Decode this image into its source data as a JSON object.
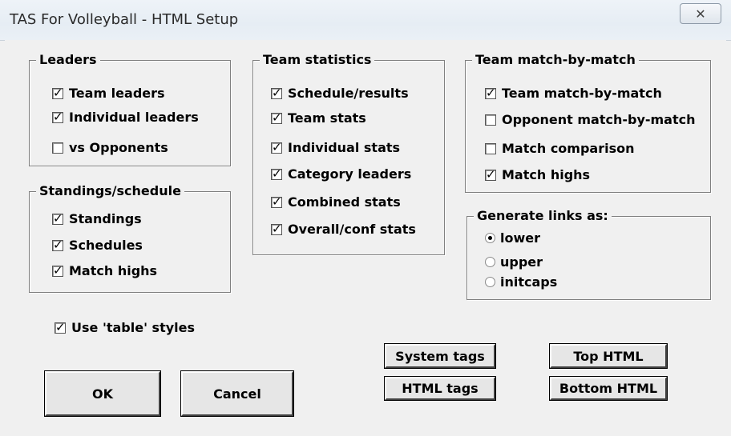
{
  "window": {
    "title": "TAS For Volleyball - HTML Setup",
    "close_glyph": "✕"
  },
  "leaders": {
    "title": "Leaders",
    "items": [
      {
        "label": "Team leaders",
        "checked": true
      },
      {
        "label": "Individual leaders",
        "checked": true
      },
      {
        "label": "vs Opponents",
        "checked": false
      }
    ]
  },
  "standings": {
    "title": "Standings/schedule",
    "items": [
      {
        "label": "Standings",
        "checked": true
      },
      {
        "label": "Schedules",
        "checked": true
      },
      {
        "label": "Match highs",
        "checked": true
      }
    ]
  },
  "team_stats": {
    "title": "Team statistics",
    "items": [
      {
        "label": "Schedule/results",
        "checked": true
      },
      {
        "label": "Team stats",
        "checked": true
      },
      {
        "label": "Individual stats",
        "checked": true
      },
      {
        "label": "Category leaders",
        "checked": true
      },
      {
        "label": "Combined stats",
        "checked": true
      },
      {
        "label": "Overall/conf stats",
        "checked": true
      }
    ]
  },
  "team_mbm": {
    "title": "Team match-by-match",
    "items": [
      {
        "label": "Team match-by-match",
        "checked": true
      },
      {
        "label": "Opponent match-by-match",
        "checked": false
      },
      {
        "label": "Match comparison",
        "checked": false
      },
      {
        "label": "Match highs",
        "checked": true
      }
    ]
  },
  "links": {
    "title": "Generate links as:",
    "options": [
      {
        "label": "lower",
        "selected": true
      },
      {
        "label": "upper",
        "selected": false
      },
      {
        "label": "initcaps",
        "selected": false
      }
    ]
  },
  "table_styles": {
    "label": "Use 'table' styles",
    "checked": true
  },
  "buttons": {
    "ok": "OK",
    "cancel": "Cancel",
    "system_tags": "System tags",
    "html_tags": "HTML tags",
    "top_html": "Top HTML",
    "bottom_html": "Bottom HTML"
  }
}
